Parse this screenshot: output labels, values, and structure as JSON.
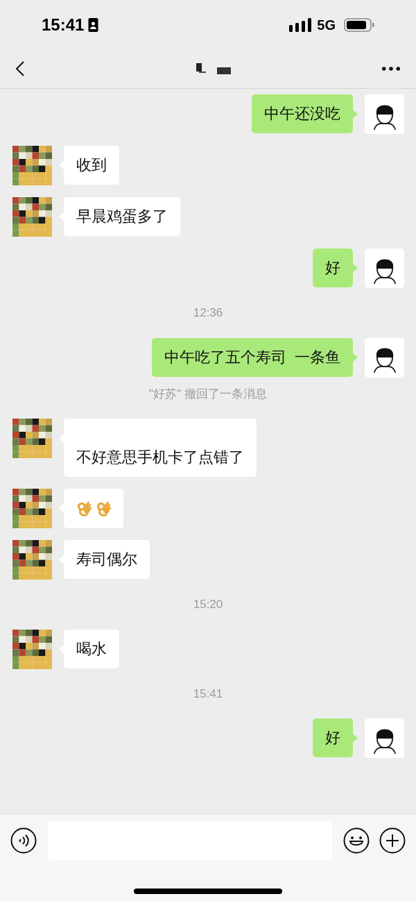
{
  "status_bar": {
    "time": "15:41",
    "network": "5G"
  },
  "messages": [
    {
      "kind": "sent",
      "text": "中午还没吃"
    },
    {
      "kind": "received",
      "text": "收到"
    },
    {
      "kind": "received",
      "text": "早晨鸡蛋多了"
    },
    {
      "kind": "sent",
      "text": "好"
    },
    {
      "kind": "time",
      "text": "12:36"
    },
    {
      "kind": "sent",
      "text": "中午吃了五个寿司  一条鱼"
    },
    {
      "kind": "notice",
      "text": "\"好苏\" 撤回了一条消息"
    },
    {
      "kind": "received",
      "text": "不好意思手机卡了点错了",
      "tall": true
    },
    {
      "kind": "received_emoji",
      "emoji": [
        {
          "kind": "ok_hand"
        },
        {
          "kind": "ok_hand"
        }
      ]
    },
    {
      "kind": "received",
      "text": "寿司偶尔"
    },
    {
      "kind": "time",
      "text": "15:20"
    },
    {
      "kind": "received",
      "text": "喝水"
    },
    {
      "kind": "time",
      "text": "15:41"
    },
    {
      "kind": "sent",
      "text": "好"
    }
  ]
}
